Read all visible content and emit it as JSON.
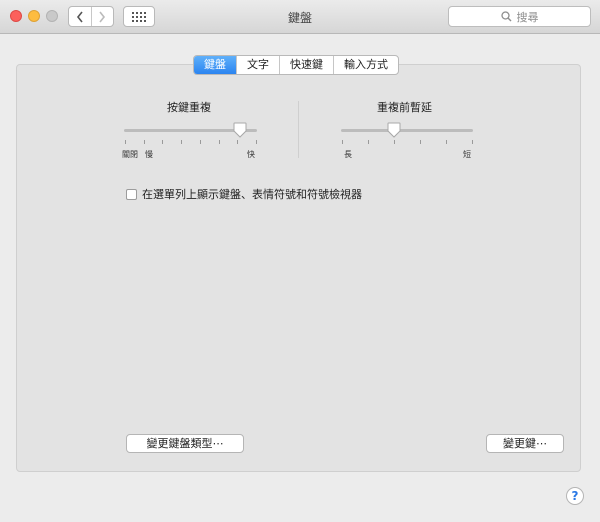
{
  "window": {
    "title": "鍵盤"
  },
  "toolbar": {
    "back_icon": "chevron-left-icon",
    "forward_icon": "chevron-right-icon",
    "show_all_icon": "grid-icon",
    "search_placeholder": "搜尋"
  },
  "tabs": [
    {
      "label": "鍵盤",
      "active": true
    },
    {
      "label": "文字",
      "active": false
    },
    {
      "label": "快速鍵",
      "active": false
    },
    {
      "label": "輸入方式",
      "active": false
    }
  ],
  "key_repeat": {
    "title": "按鍵重複",
    "label_off": "關閉",
    "label_slow": "慢",
    "label_fast": "快",
    "level": 0.87
  },
  "delay_until_repeat": {
    "title": "重複前暫延",
    "label_long": "長",
    "label_short": "短",
    "level": 0.4
  },
  "show_viewers_checkbox": {
    "label": "在選單列上顯示鍵盤、表情符號和符號檢視器",
    "checked": false
  },
  "buttons": {
    "change_keyboard_type": "變更鍵盤類型⋯",
    "modifier_keys": "變更鍵⋯"
  },
  "help": {
    "label": "?"
  },
  "colors": {
    "accent": "#2b84f0"
  }
}
